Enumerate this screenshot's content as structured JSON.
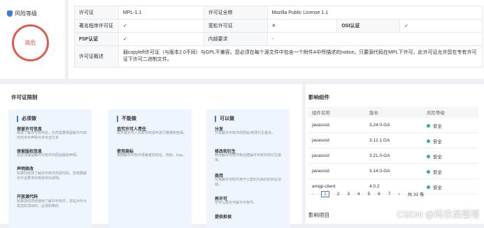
{
  "risk": {
    "title": "风险等级",
    "level": "高危"
  },
  "license": {
    "rows": [
      [
        {
          "k": "许可证",
          "v": "MPL-1.1"
        },
        {
          "k": "许可证全称",
          "v": "Mozilla Public License 1.1"
        }
      ],
      [
        {
          "k": "著名程序许可证",
          "v": "✓",
          "vc": "ok"
        },
        {
          "k": "宽松许可证",
          "v": "✕",
          "vc": "no"
        },
        {
          "k": "OSI认证",
          "v": "✓",
          "vc": "ok"
        }
      ],
      [
        {
          "k": "FSF认证",
          "v": "✓",
          "vc": "ok"
        },
        {
          "k": "内部要求",
          "v": "-"
        }
      ]
    ],
    "summary_label": "许可证概述",
    "summary": "弱copyleft许可证（与版本2.0不同）与GPL不兼容。您必须在每个源文件中包含一个附件A中所描述的notice。只要源代码在MPL下许可，此许可证允许您在专有许可证下许可二进制文件。"
  },
  "rules": {
    "title": "许可证限制",
    "columns": [
      {
        "title": "必须做",
        "items": [
          {
            "t": "保留许可信息",
            "d": "修改了解许可软件后，仍然需要保留解许可软件的许可声明与许可证文本"
          },
          {
            "t": "保留版权信息",
            "d": "您必须保留解许可软件的原始版权声明。"
          },
          {
            "t": "声明修改",
            "d": "如果你修改了解许可软件的源代码，您需要解许可证要求对修改作出说明。"
          },
          {
            "t": "开放源代码",
            "d": "如果您的项目使用了解许可软件，您在对外分发您的项目时，必须附带的"
          }
        ]
      },
      {
        "title": "不能做",
        "items": [
          {
            "t": "追究许可人责任",
            "d": "软件或许可人对软件的损坏进行赔偿和担保。"
          },
          {
            "t": "使用商标",
            "d": "使用解许可软件贡献者的姓名、商标、logo。"
          }
        ]
      },
      {
        "title": "可以做",
        "items": [
          {
            "t": "分发",
            "d": "分发解许可软件的原始/修改衍生版本。"
          },
          {
            "t": "修改和衍生",
            "d": "修改解许可软件和创建解许可软件的衍生版本。"
          },
          {
            "t": "商用",
            "d": "可将解许可软件用于以营利为目的的商业活动。"
          },
          {
            "t": "再许可",
            "d": "您可以再许可解许可软件。"
          },
          {
            "t": "提供担保",
            "d": ""
          }
        ]
      }
    ]
  },
  "components": {
    "title": "影响组件",
    "headers": [
      "组件名称",
      "版本",
      "风险等级"
    ],
    "rows": [
      {
        "name": "javassist",
        "version": "3.24.0-GA",
        "risk": "安全"
      },
      {
        "name": "javassist",
        "version": "3.12.1.GA",
        "risk": "安全"
      },
      {
        "name": "javassist",
        "version": "3.21.0-GA",
        "risk": "安全"
      },
      {
        "name": "javassist",
        "version": "3.14.0-GA",
        "risk": "安全"
      },
      {
        "name": "amqp-client",
        "version": "4.0.2",
        "risk": "安全"
      }
    ],
    "pager": {
      "prev": "‹",
      "pages": [
        "1",
        "2",
        "3",
        "4",
        "5",
        "6",
        "7"
      ],
      "current": "1",
      "next": "›",
      "total": "共 31 条"
    },
    "projects_title": "影响项目"
  },
  "watermark": "CSDN @码农吴霸哥"
}
